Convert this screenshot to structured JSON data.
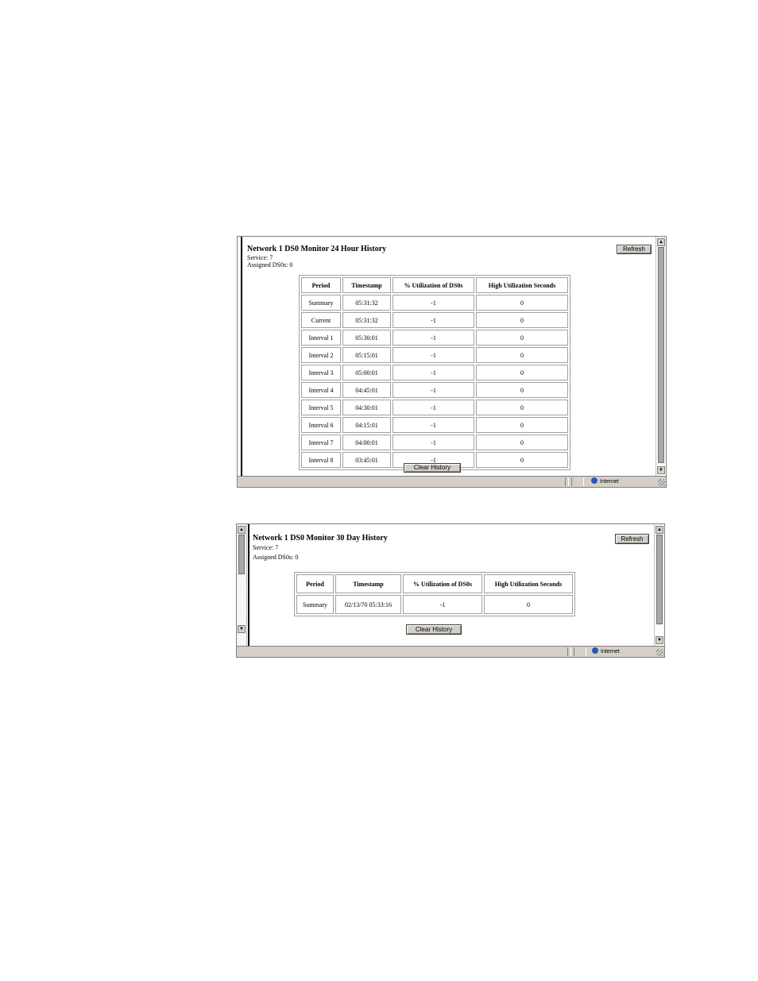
{
  "window_24h": {
    "title": "Network 1 DS0 Monitor 24 Hour History",
    "service_line": "Service: 7",
    "assigned_line": "Assigned DS0s: 0",
    "refresh_label": "Refresh",
    "clear_label": "Clear History",
    "columns": [
      "Period",
      "Timestamp",
      "% Utilization of DS0s",
      "High Utilization Seconds"
    ],
    "rows": [
      [
        "Summary",
        "05:31:32",
        "-1",
        "0"
      ],
      [
        "Current",
        "05:31:32",
        "-1",
        "0"
      ],
      [
        "Interval 1",
        "05:30:01",
        "-1",
        "0"
      ],
      [
        "Interval 2",
        "05:15:01",
        "-1",
        "0"
      ],
      [
        "Interval 3",
        "05:00:01",
        "-1",
        "0"
      ],
      [
        "Interval 4",
        "04:45:01",
        "-1",
        "0"
      ],
      [
        "Interval 5",
        "04:30:01",
        "-1",
        "0"
      ],
      [
        "Interval 6",
        "04:15:01",
        "-1",
        "0"
      ],
      [
        "Interval 7",
        "04:00:01",
        "-1",
        "0"
      ],
      [
        "Interval 8",
        "03:45:01",
        "-1",
        "0"
      ]
    ],
    "status_zone": "Internet",
    "zone_icon": "globe-icon"
  },
  "window_30d": {
    "title": "Network 1 DS0 Monitor 30 Day History",
    "service_line": "Service: 7",
    "assigned_line": "Assigned DS0s: 0",
    "refresh_label": "Refresh",
    "clear_label": "Clear History",
    "columns": [
      "Period",
      "Timestamp",
      "% Utilization of DS0s",
      "High Utilization Seconds"
    ],
    "rows": [
      [
        "Summary",
        "02/13/70 05:33:16",
        "-1",
        "0"
      ]
    ],
    "status_zone": "Internet",
    "zone_icon": "globe-icon"
  },
  "colors": {
    "chrome": "#d4d0c8",
    "border": "#808080",
    "globe": "#2a58b8"
  }
}
